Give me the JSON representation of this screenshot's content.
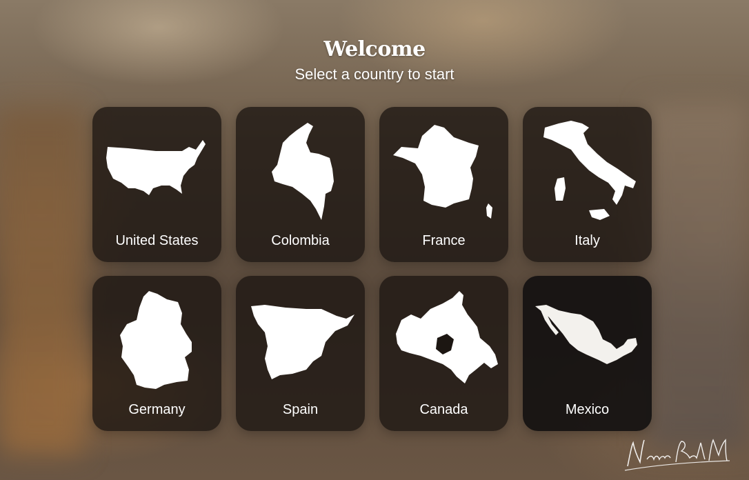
{
  "header": {
    "title": "Welcome",
    "subtitle": "Select a country to start"
  },
  "countries": [
    {
      "label": "United States",
      "icon": "usa-map-icon"
    },
    {
      "label": "Colombia",
      "icon": "colombia-map-icon"
    },
    {
      "label": "France",
      "icon": "france-map-icon"
    },
    {
      "label": "Italy",
      "icon": "italy-map-icon"
    },
    {
      "label": "Germany",
      "icon": "germany-map-icon"
    },
    {
      "label": "Spain",
      "icon": "spain-map-icon"
    },
    {
      "label": "Canada",
      "icon": "canada-map-icon"
    },
    {
      "label": "Mexico",
      "icon": "mexico-map-icon"
    }
  ],
  "signature": {
    "text": "Nicolás Pardo M"
  },
  "colors": {
    "card_bg": "#1c1612",
    "text": "#ffffff",
    "map_fill": "#ffffff"
  }
}
